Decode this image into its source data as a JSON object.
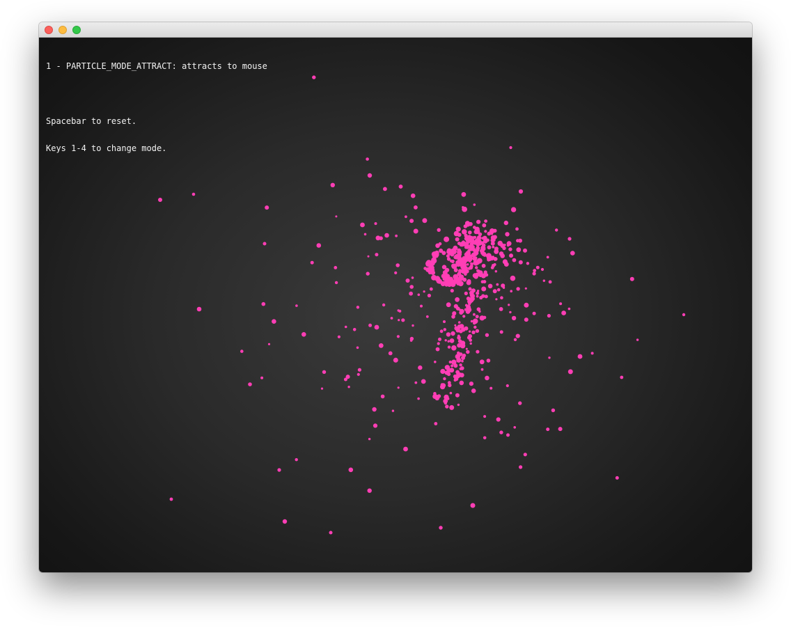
{
  "window": {
    "controls": [
      {
        "name": "close",
        "color": "#fc605c"
      },
      {
        "name": "minimize",
        "color": "#fdbc40"
      },
      {
        "name": "maximize",
        "color": "#34c84a"
      }
    ]
  },
  "hud": {
    "mode_line": "1 - PARTICLE_MODE_ATTRACT: attracts to mouse",
    "reset_line": "Spacebar to reset.",
    "keys_line": "Keys 1-4 to change mode."
  },
  "particles": {
    "color": "#ff3eb5",
    "mode": "attract"
  }
}
